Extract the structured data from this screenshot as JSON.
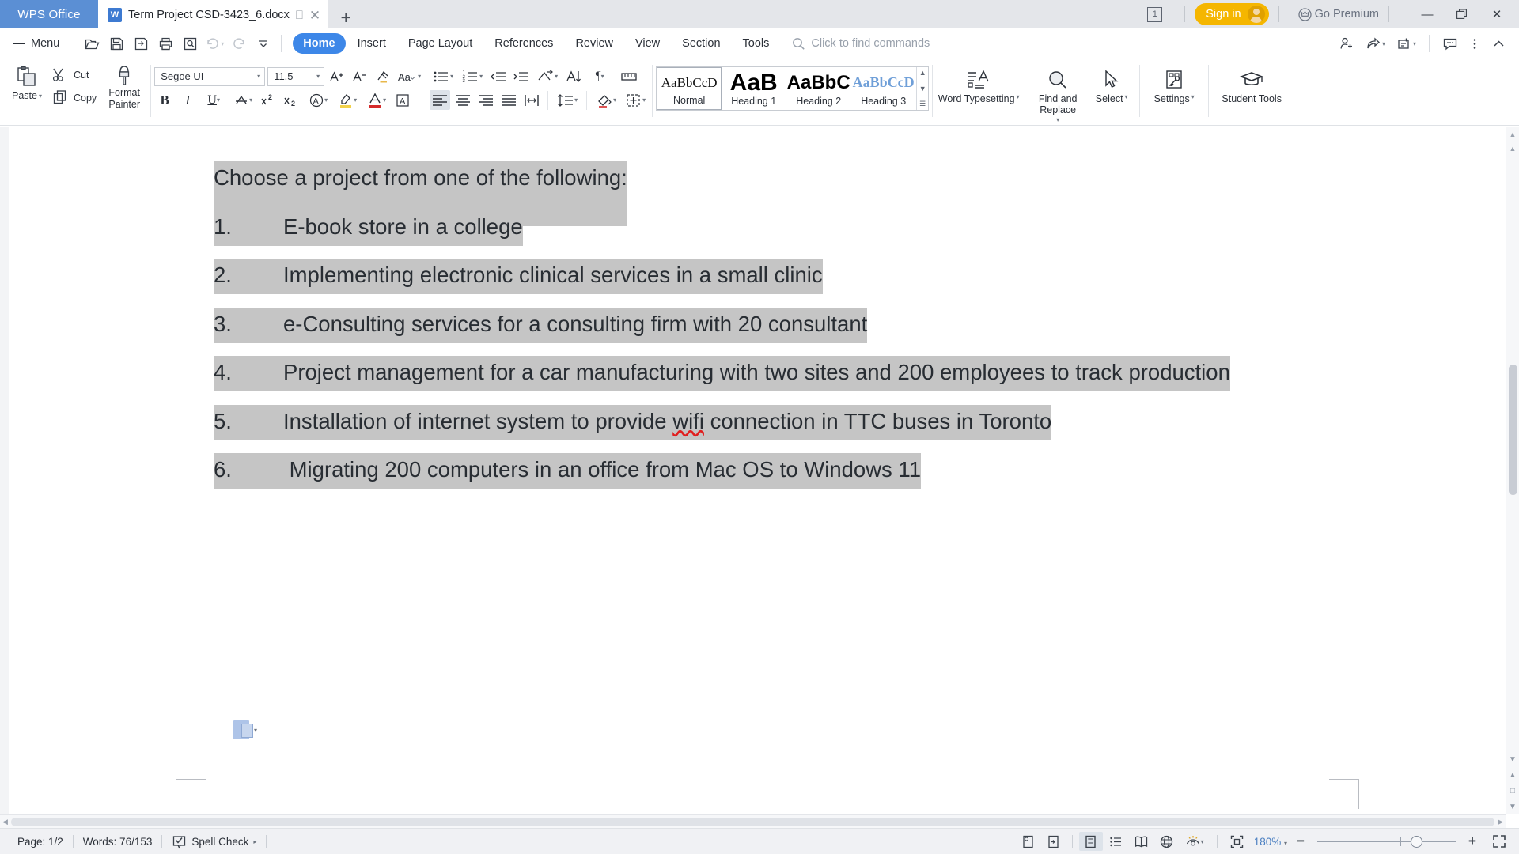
{
  "titlebar": {
    "brand": "WPS Office",
    "tab": {
      "name": "Term Project CSD-3423_6.docx",
      "restore_icon": "restore-icon",
      "close_icon": "close-icon"
    },
    "new_tab_label": "+",
    "page_count_badge": "1",
    "sign_in_label": "Sign in",
    "go_premium_label": "Go Premium",
    "minimize_label": "—",
    "maximize_label": "❐",
    "close_label": "✕"
  },
  "menurow": {
    "menu_label": "Menu",
    "quick_access": [
      {
        "name": "open-icon"
      },
      {
        "name": "save-icon"
      },
      {
        "name": "save-as-icon"
      },
      {
        "name": "print-icon"
      },
      {
        "name": "print-preview-icon"
      },
      {
        "name": "undo-icon"
      },
      {
        "name": "redo-icon"
      },
      {
        "name": "customize-quick-access-icon"
      }
    ],
    "tabs": [
      {
        "label": "Home",
        "active": true
      },
      {
        "label": "Insert",
        "active": false
      },
      {
        "label": "Page Layout",
        "active": false
      },
      {
        "label": "References",
        "active": false
      },
      {
        "label": "Review",
        "active": false
      },
      {
        "label": "View",
        "active": false
      },
      {
        "label": "Section",
        "active": false
      },
      {
        "label": "Tools",
        "active": false
      }
    ],
    "find_commands_placeholder": "Click to find commands",
    "right_actions": [
      {
        "name": "share-user-icon"
      },
      {
        "name": "share-icon"
      },
      {
        "name": "annotate-icon"
      },
      {
        "name": "comment-icon"
      },
      {
        "name": "more-options-icon"
      },
      {
        "name": "collapse-ribbon-icon"
      }
    ]
  },
  "ribbon": {
    "clipboard": {
      "paste_label": "Paste",
      "cut_label": "Cut",
      "copy_label": "Copy",
      "format_painter_label": "Format Painter"
    },
    "font": {
      "family": "Segoe UI",
      "size": "11.5",
      "buttons": [
        "grow-font-icon",
        "shrink-font-icon",
        "clear-formatting-icon",
        "change-case-icon",
        "bold-icon",
        "italic-icon",
        "underline-icon",
        "strikethrough-icon",
        "superscript-icon",
        "subscript-icon",
        "text-effects-icon",
        "highlight-color-icon",
        "font-color-icon",
        "character-border-icon"
      ]
    },
    "paragraph": {
      "buttons": [
        "bullet-list-icon",
        "numbered-list-icon",
        "decrease-indent-icon",
        "increase-indent-icon",
        "multilevel-list-icon",
        "sort-icon",
        "show-formatting-marks-icon",
        "ruler-icon",
        "align-left-icon",
        "align-center-icon",
        "align-right-icon",
        "justify-icon",
        "distribute-icon",
        "line-spacing-icon",
        "shading-icon",
        "borders-icon"
      ],
      "active_button": "align-left-icon"
    },
    "styles": [
      {
        "preview": "AaBbCcD",
        "name": "Normal",
        "selected": true
      },
      {
        "preview": "AaB",
        "name": "Heading 1",
        "selected": false
      },
      {
        "preview": "AaBbC",
        "name": "Heading 2",
        "selected": false
      },
      {
        "preview": "AaBbCcD",
        "name": "Heading 3",
        "selected": false
      }
    ],
    "tools": [
      {
        "label": "Word Typesetting",
        "icon": "word-typesetting-icon",
        "dropdown": true
      },
      {
        "label": "Find and Replace",
        "icon": "search-icon",
        "dropdown": true
      },
      {
        "label": "Select",
        "icon": "cursor-icon",
        "dropdown": true
      },
      {
        "label": "Settings",
        "icon": "settings-icon",
        "dropdown": true
      },
      {
        "label": "Student Tools",
        "icon": "graduation-cap-icon",
        "dropdown": false
      }
    ]
  },
  "document": {
    "intro": "Choose a project  from one of the following:",
    "items": [
      {
        "num": "1.",
        "text": "E-book store in a college"
      },
      {
        "num": "2.",
        "text": "Implementing electronic clinical services in a small clinic"
      },
      {
        "num": "3.",
        "text": "e-Consulting services for a consulting firm with 20 consultant"
      },
      {
        "num": "4.",
        "text": "Project management for a car manufacturing with two sites and 200 employees to track production"
      },
      {
        "num": "5.",
        "text_before": "Installation of internet system to provide ",
        "misspelled": "wifi",
        "text_after": " connection in TTC buses in Toronto"
      },
      {
        "num": "6.",
        "text": " Migrating 200 computers in an office from Mac OS to Windows 11"
      }
    ],
    "paste_options_tag": "paste-options-icon",
    "highlight_color": "#c5c5c5"
  },
  "statusbar": {
    "page": "Page: 1/2",
    "words": "Words: 76/153",
    "spell_check": "Spell Check",
    "view_icons": [
      "page-layout-icon",
      "full-screen-reading-icon",
      "print-layout-icon",
      "outline-icon",
      "reading-layout-icon",
      "web-layout-icon",
      "eye-protection-icon"
    ],
    "active_view": "print-layout-icon",
    "fit_icon": "fit-page-icon",
    "zoom": "180%",
    "zoom_out_label": "−",
    "zoom_in_label": "+",
    "fullscreen_icon": "fullscreen-icon"
  },
  "colors": {
    "brand_blue": "#5b8fd4",
    "tab_active_blue": "#3d87e8",
    "accent_yellow": "#f5b600",
    "highlight_gray": "#c5c5c5",
    "spell_error_red": "#e02020"
  }
}
